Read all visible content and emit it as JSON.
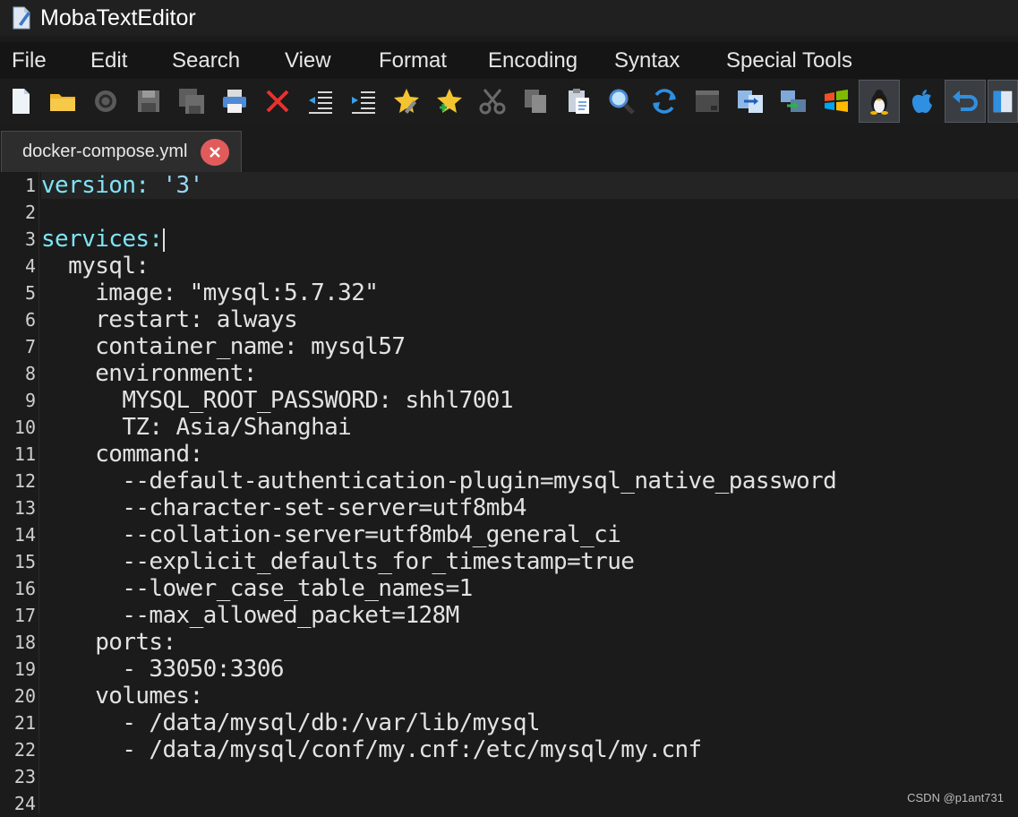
{
  "window": {
    "title": "MobaTextEditor"
  },
  "menu": [
    "File",
    "Edit",
    "Search",
    "View",
    "Format",
    "Encoding",
    "Syntax",
    "Special Tools"
  ],
  "toolbar": {
    "buttons": [
      {
        "icon": "new-file-icon"
      },
      {
        "icon": "open-folder-icon"
      },
      {
        "icon": "reload-icon"
      },
      {
        "icon": "save-icon"
      },
      {
        "icon": "save-all-icon"
      },
      {
        "icon": "print-icon"
      },
      {
        "icon": "close-icon"
      },
      {
        "icon": "outdent-icon"
      },
      {
        "icon": "indent-icon"
      },
      {
        "icon": "bookmark-edit-icon"
      },
      {
        "icon": "bookmark-add-icon"
      },
      {
        "icon": "cut-icon"
      },
      {
        "icon": "copy-icon"
      },
      {
        "icon": "paste-icon"
      },
      {
        "icon": "find-icon"
      },
      {
        "icon": "replace-icon"
      },
      {
        "icon": "terminal-icon"
      },
      {
        "icon": "compare-icon"
      },
      {
        "icon": "network-icon"
      },
      {
        "icon": "windows-icon"
      },
      {
        "icon": "linux-icon",
        "active": true
      },
      {
        "icon": "mac-icon"
      },
      {
        "icon": "undo-icon",
        "active": true
      },
      {
        "icon": "panel-icon",
        "active": true
      }
    ]
  },
  "tabs": [
    {
      "label": "docker-compose.yml"
    }
  ],
  "editor": {
    "line_numbers": [
      "1",
      "2",
      "3",
      "4",
      "5",
      "6",
      "7",
      "8",
      "9",
      "10",
      "11",
      "12",
      "13",
      "14",
      "15",
      "16",
      "17",
      "18",
      "19",
      "20",
      "21",
      "22",
      "23",
      "24"
    ],
    "lines": [
      "version: '3'",
      "",
      "services:",
      "  mysql:",
      "    image: \"mysql:5.7.32\"",
      "    restart: always",
      "    container_name: mysql57",
      "    environment:",
      "      MYSQL_ROOT_PASSWORD: shhl7001",
      "      TZ: Asia/Shanghai",
      "    command:",
      "      --default-authentication-plugin=mysql_native_password",
      "      --character-set-server=utf8mb4",
      "      --collation-server=utf8mb4_general_ci",
      "      --explicit_defaults_for_timestamp=true",
      "      --lower_case_table_names=1",
      "      --max_allowed_packet=128M",
      "    ports:",
      "      - 33050:3306",
      "    volumes:",
      "      - /data/mysql/db:/var/lib/mysql",
      "      - /data/mysql/conf/my.cnf:/etc/mysql/my.cnf",
      "",
      ""
    ],
    "top_level": {
      "version_key": "version:",
      "version_value": "'3'",
      "services_key": "services:"
    }
  },
  "watermark": "CSDN @p1ant731",
  "colors": {
    "accent_key": "#7fe4f5",
    "tab_close": "#e25b5b"
  }
}
